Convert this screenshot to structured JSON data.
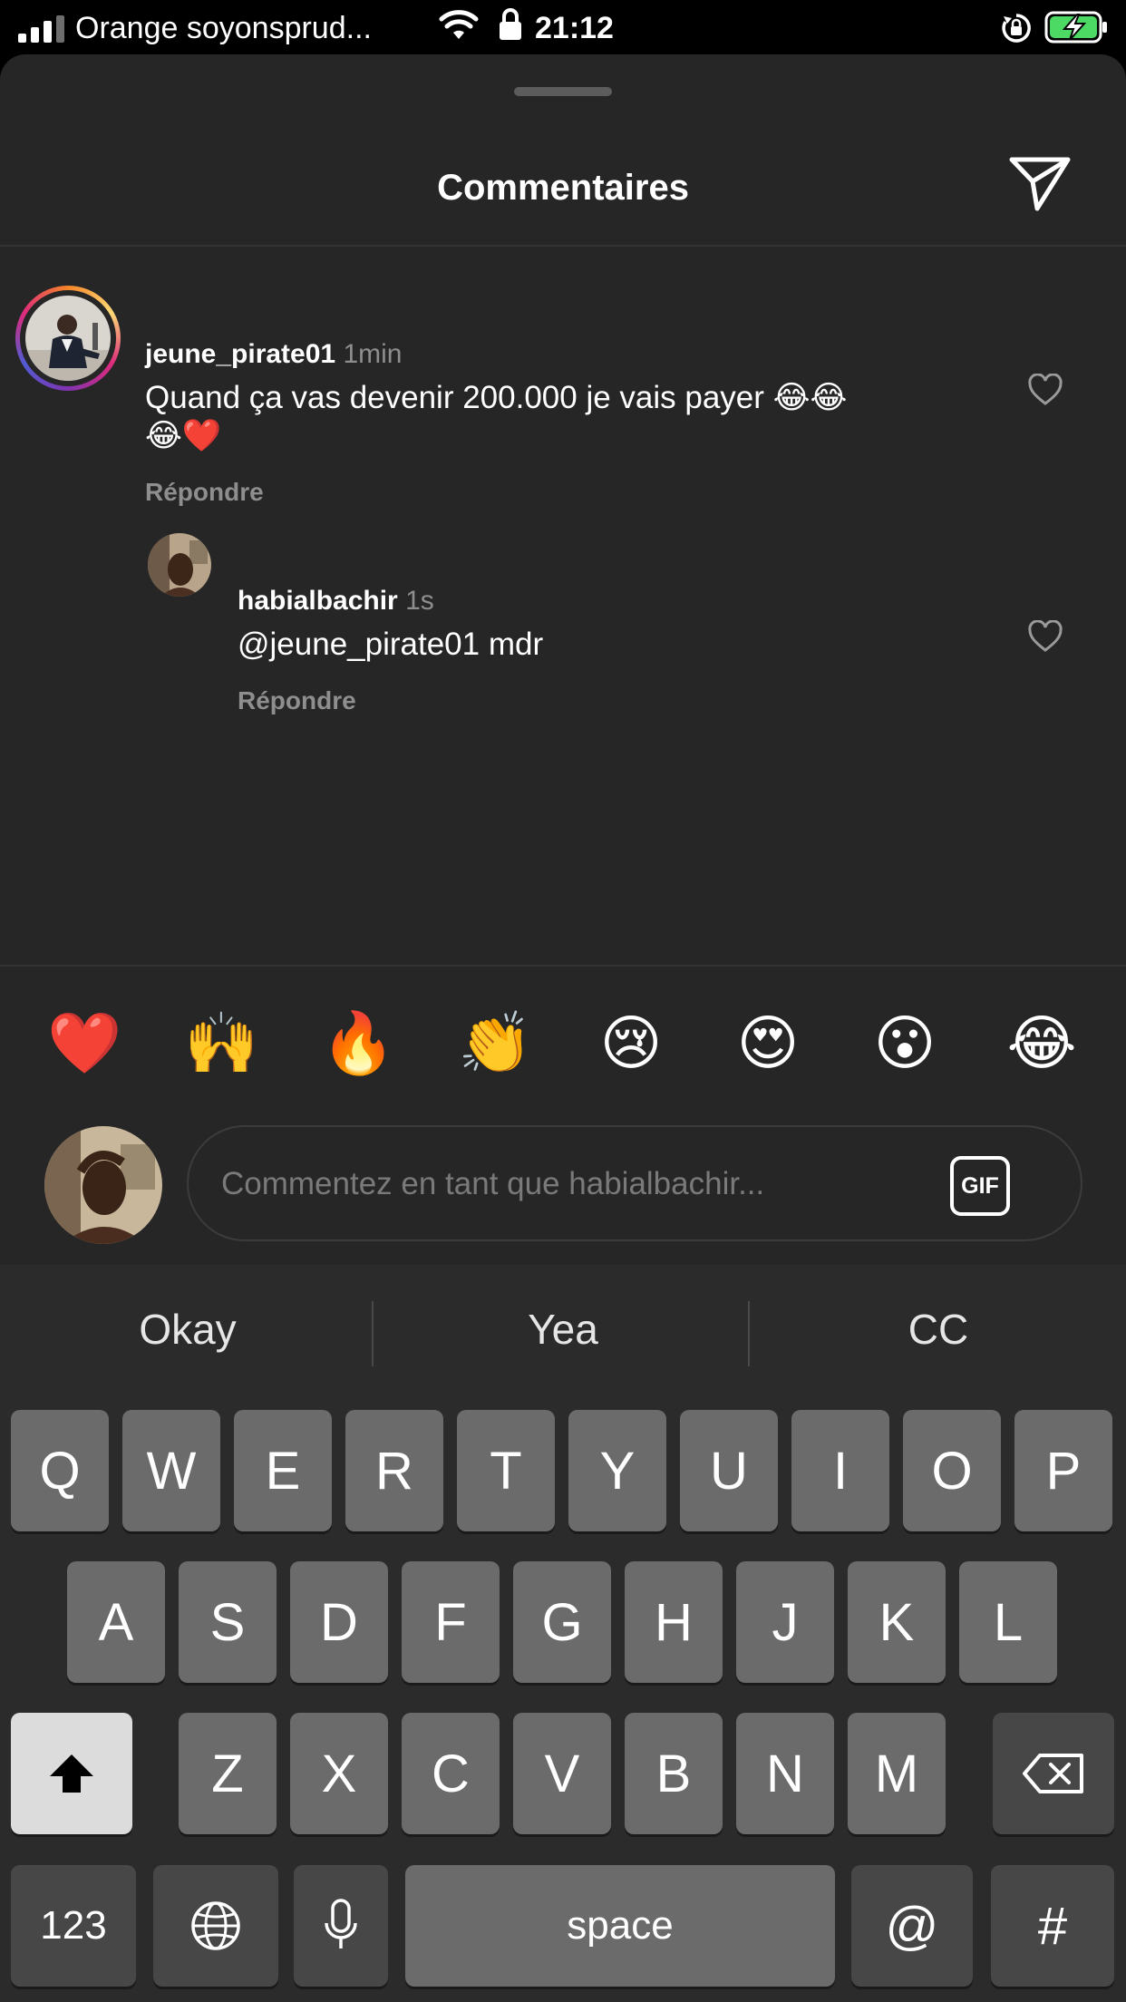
{
  "status_bar": {
    "carrier": "Orange soyonsprud...",
    "time": "21:12",
    "icons": [
      "signal-icon",
      "wifi-icon",
      "lock-icon",
      "rotation-lock-icon",
      "battery-charging-icon"
    ]
  },
  "header": {
    "title": "Commentaires",
    "share_icon": "send-icon"
  },
  "comments": [
    {
      "username": "jeune_pirate01",
      "time": "1min",
      "text": "Quand ça vas devenir 200.000 je vais payer 😂😂",
      "text_line2": "😂❤️",
      "reply_label": "Répondre"
    },
    {
      "username": "habialbachir",
      "time": "1s",
      "text": "@jeune_pirate01 mdr",
      "reply_label": "Répondre"
    }
  ],
  "reactions": [
    "❤️",
    "🙌",
    "🔥",
    "👏",
    "😢",
    "😍",
    "😮",
    "😂"
  ],
  "composer": {
    "placeholder": "Commentez en tant que habialbachir...",
    "gif_label": "GIF"
  },
  "keyboard": {
    "suggestions": [
      "Okay",
      "Yea",
      "CC"
    ],
    "row1": [
      "Q",
      "W",
      "E",
      "R",
      "T",
      "Y",
      "U",
      "I",
      "O",
      "P"
    ],
    "row2": [
      "A",
      "S",
      "D",
      "F",
      "G",
      "H",
      "J",
      "K",
      "L"
    ],
    "row3": [
      "Z",
      "X",
      "C",
      "V",
      "B",
      "N",
      "M"
    ],
    "numbers_label": "123",
    "space_label": "space",
    "at_label": "@",
    "hash_label": "#"
  },
  "colors": {
    "sheet_bg": "#262626",
    "secondary_text": "#8e8e8e",
    "key_bg": "#6b6b6b",
    "keyboard_bg": "#2b2b2b"
  }
}
